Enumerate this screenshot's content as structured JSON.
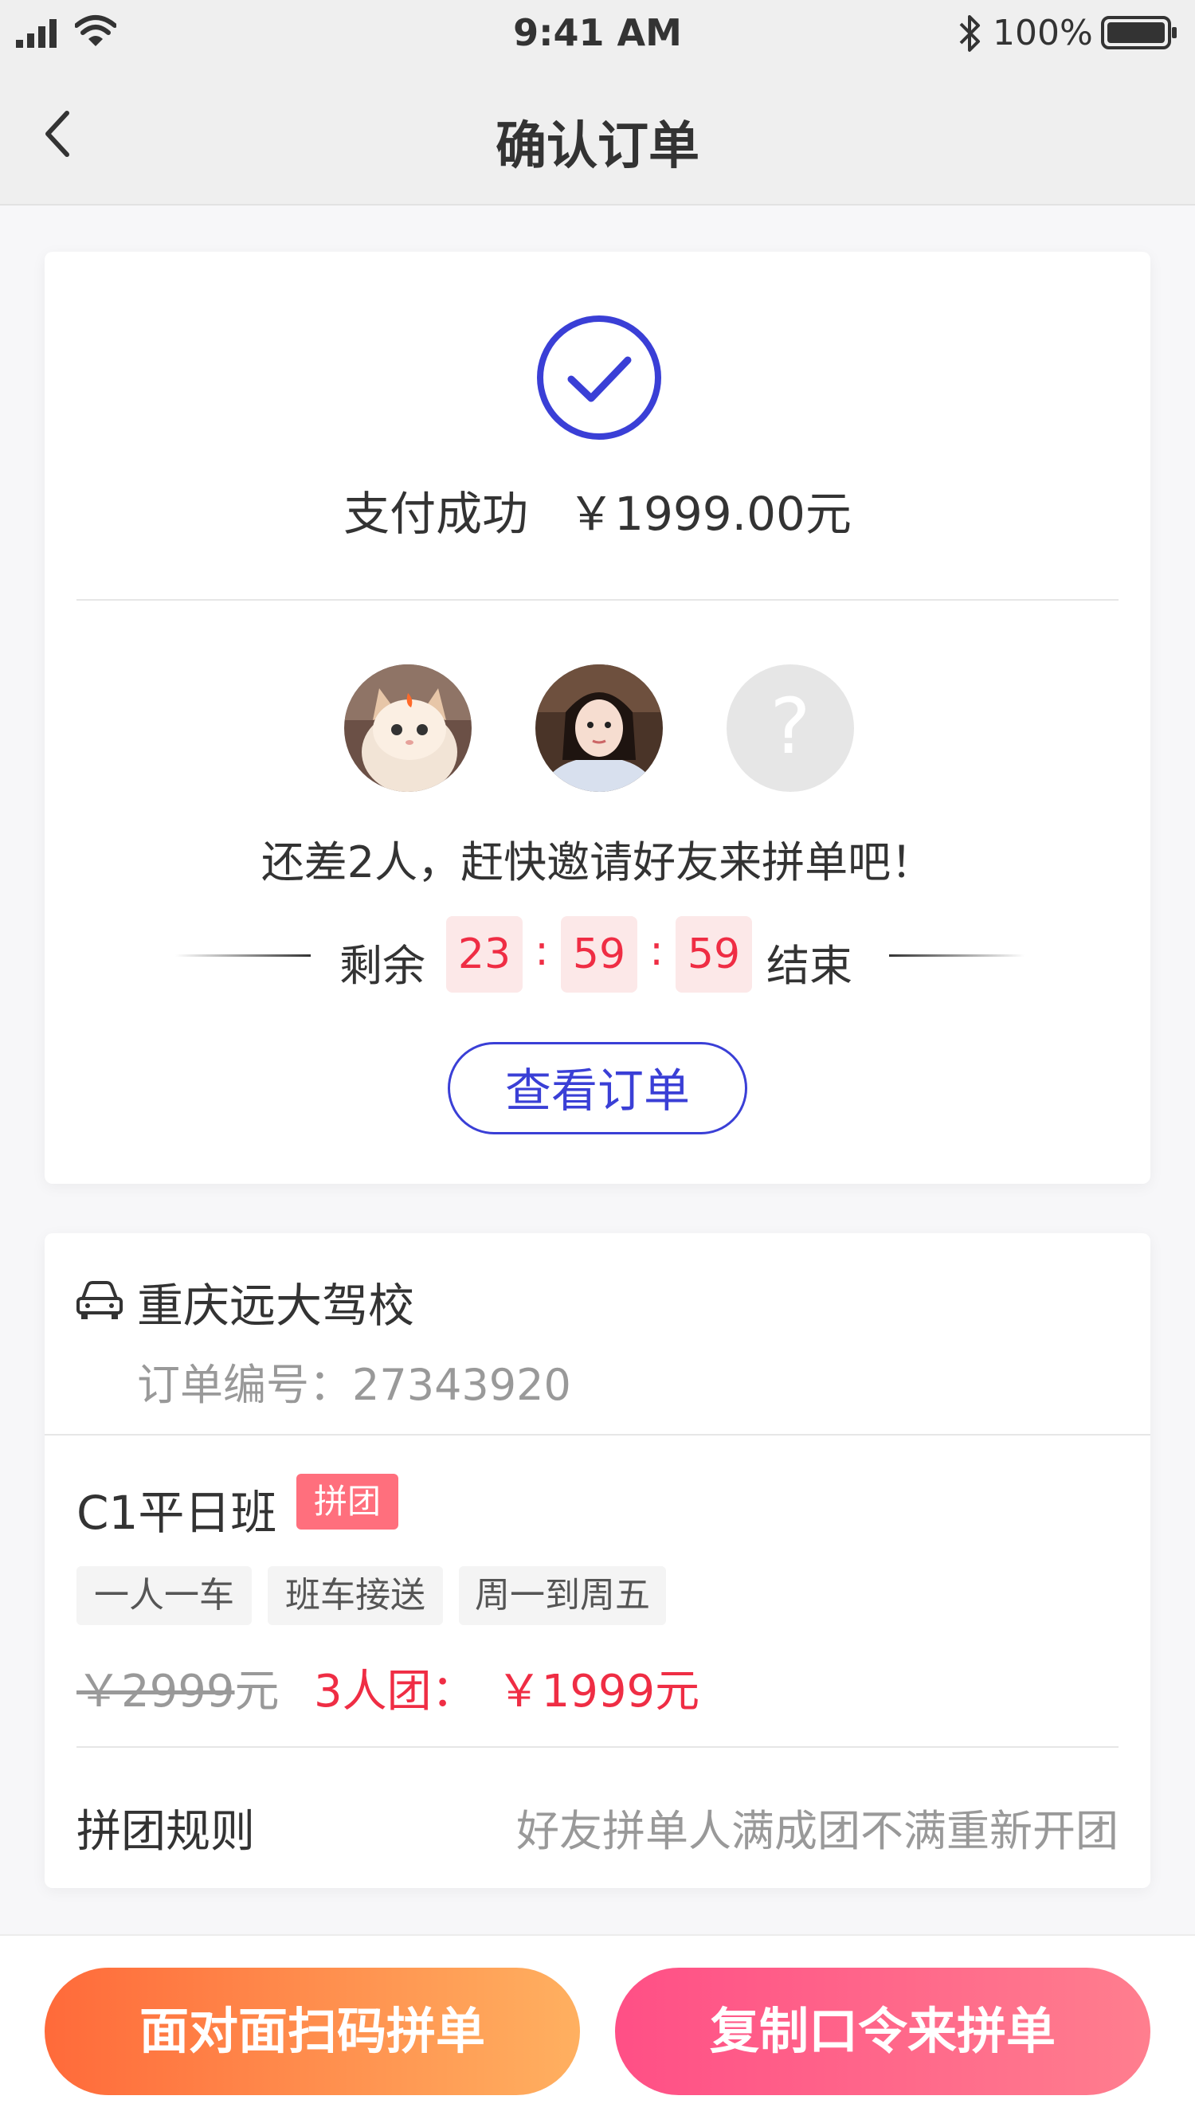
{
  "status_bar": {
    "time": "9:41 AM",
    "battery": "100%",
    "icons": [
      "signal-icon",
      "wifi-icon",
      "bluetooth-icon",
      "battery-icon"
    ]
  },
  "nav": {
    "title": "确认订单",
    "back_icon": "chevron-left-icon"
  },
  "payment": {
    "status": "支付成功",
    "amount": "￥1999.00元",
    "icon": "check-circle-icon"
  },
  "group": {
    "members": [
      {
        "type": "photo",
        "icon": "kitten-avatar"
      },
      {
        "type": "photo",
        "icon": "girl-avatar"
      },
      {
        "type": "placeholder",
        "symbol": "?"
      }
    ],
    "invite_message": "还差2人，赶快邀请好友来拼单吧！",
    "countdown": {
      "prefix": "剩余",
      "hours": "23",
      "minutes": "59",
      "seconds": "59",
      "separator": ":",
      "suffix": "结束"
    },
    "view_order_label": "查看订单"
  },
  "order": {
    "school_name": "重庆远大驾校",
    "order_number_label": "订单编号：",
    "order_number": "27343920",
    "product_name": "C1平日班",
    "badge": "拼团",
    "tags": [
      "一人一车",
      "班车接送",
      "周一到周五"
    ],
    "original_price": "￥2999",
    "original_unit": "元",
    "group_price_label": "3人团：",
    "group_price": "￥1999元",
    "rules_label": "拼团规则",
    "rules_value": "好友拼单人满成团不满重新开团"
  },
  "actions": {
    "face_to_face": "面对面扫码拼单",
    "copy_code": "复制口令来拼单"
  },
  "colors": {
    "accent_blue": "#3a3fd6",
    "price_red": "#ef2d44",
    "badge_pink": "#ff6f7d",
    "btn_orange_start": "#ff6a3a",
    "btn_orange_end": "#ffb060",
    "btn_pink_start": "#ff4f86",
    "btn_pink_end": "#ff7e8e"
  }
}
